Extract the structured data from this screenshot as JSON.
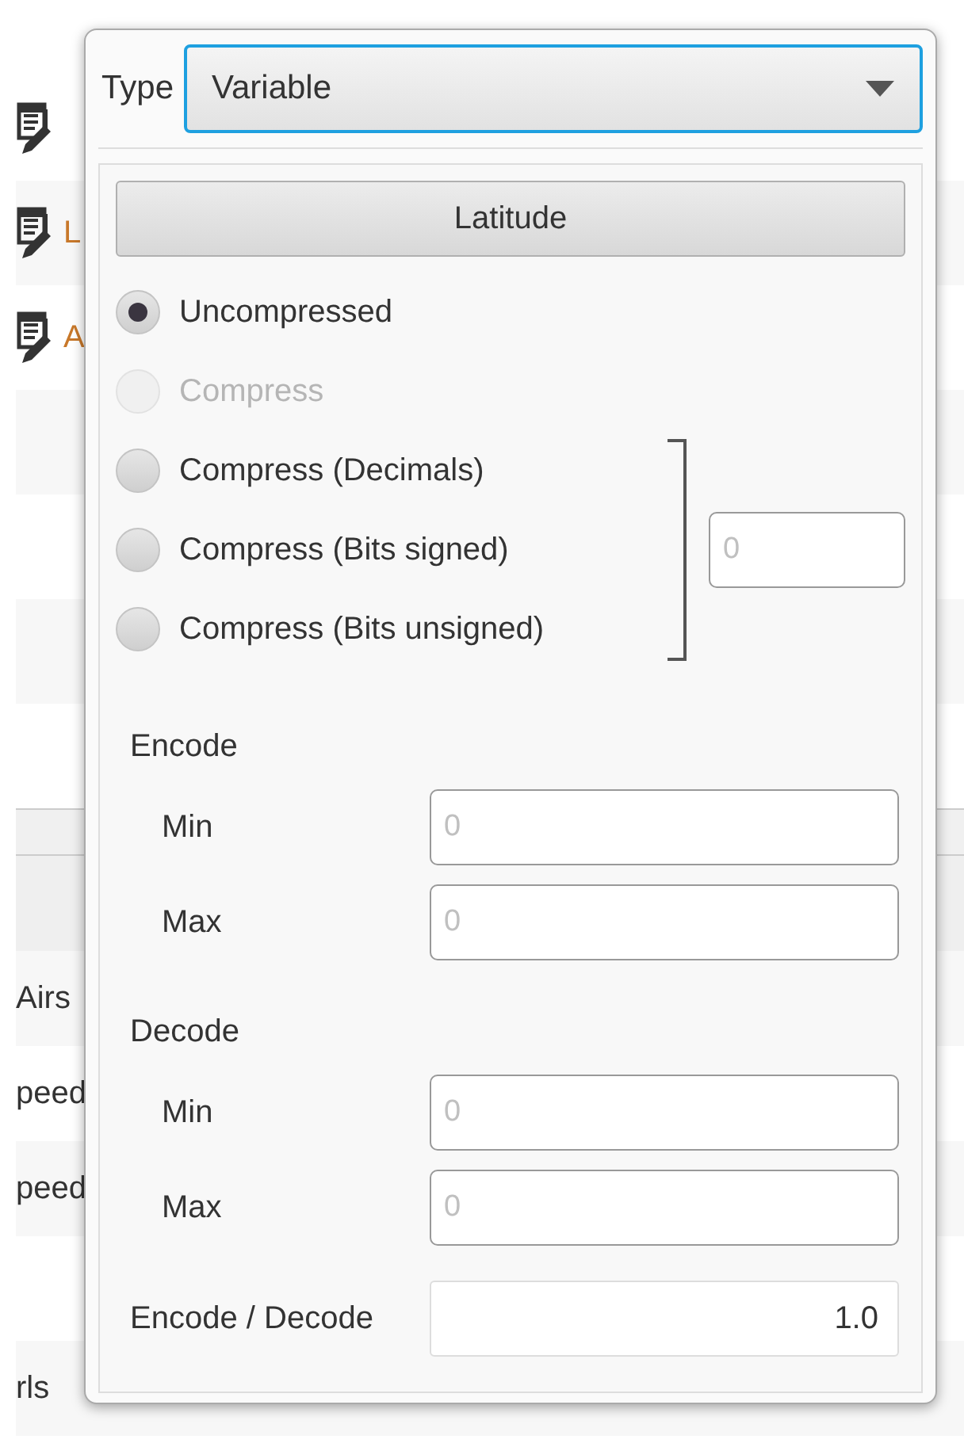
{
  "background_list": {
    "rows": [
      {
        "kind": "icon"
      },
      {
        "kind": "icon",
        "text": "L",
        "color": "#c8782a"
      },
      {
        "kind": "icon",
        "text": "A",
        "color": "#c8782a"
      },
      {
        "kind": "blank"
      },
      {
        "kind": "blank"
      },
      {
        "kind": "blank"
      },
      {
        "kind": "blank"
      },
      {
        "kind": "divider"
      },
      {
        "kind": "header"
      },
      {
        "kind": "text",
        "text": "Airs",
        "color": "#333333"
      },
      {
        "kind": "text",
        "text": "peed",
        "color": "#333333"
      },
      {
        "kind": "text",
        "text": "peed",
        "color": "#333333"
      },
      {
        "kind": "blank"
      },
      {
        "kind": "text",
        "text": "rls",
        "color": "#333333"
      }
    ]
  },
  "popover": {
    "type_label": "Type",
    "type_select": {
      "value": "Variable",
      "focused": true
    },
    "name_button": "Latitude",
    "compression": [
      {
        "label": "Uncompressed",
        "kind": "plain",
        "selected": true,
        "disabled": false
      },
      {
        "label": "Compress",
        "kind": "plain",
        "selected": false,
        "disabled": true
      },
      {
        "label": "Compress (Decimals)",
        "kind": "grouped",
        "selected": false,
        "disabled": false
      },
      {
        "label": "Compress (Bits signed)",
        "kind": "grouped",
        "selected": false,
        "disabled": false
      },
      {
        "label": "Compress (Bits unsigned)",
        "kind": "grouped",
        "selected": false,
        "disabled": false
      }
    ],
    "compression_value": {
      "placeholder": "0"
    },
    "sections": [
      {
        "title": "Encode",
        "fields": [
          {
            "label": "Min",
            "placeholder": "0"
          },
          {
            "label": "Max",
            "placeholder": "0"
          }
        ]
      },
      {
        "title": "Decode",
        "fields": [
          {
            "label": "Min",
            "placeholder": "0"
          },
          {
            "label": "Max",
            "placeholder": "0"
          }
        ]
      }
    ],
    "ratio": {
      "label": "Encode / Decode",
      "value": "1.0"
    }
  }
}
